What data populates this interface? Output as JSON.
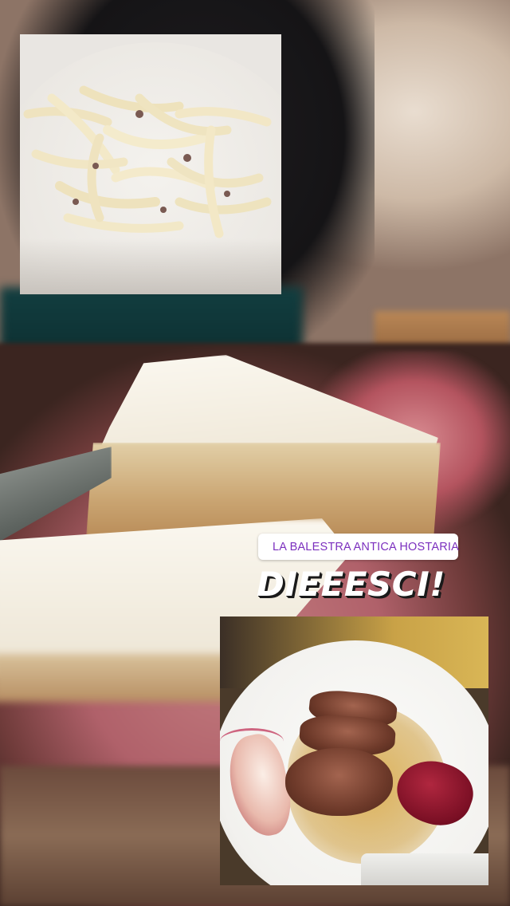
{
  "story": {
    "location_sticker": {
      "icon": "location-pin-icon",
      "label": "LA BALESTRA ANTICA HOSTARIA",
      "color": "#7b2fbe"
    },
    "text_sticker": {
      "text": "DIEEESCI!"
    },
    "photos": [
      {
        "subject": "pasta"
      },
      {
        "subject": "duck"
      }
    ]
  }
}
